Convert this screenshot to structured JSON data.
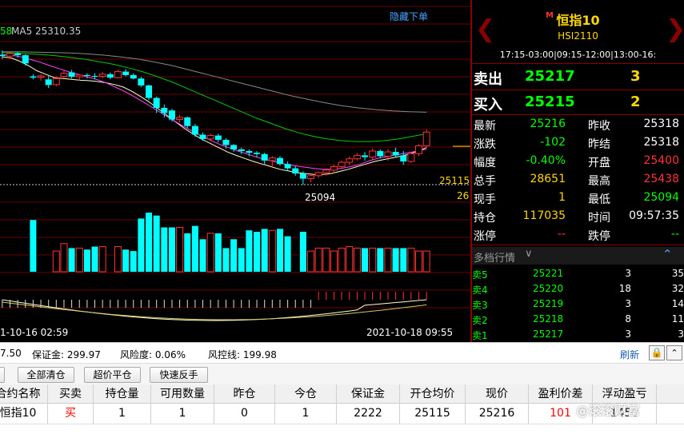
{
  "chart": {
    "top_link": "隐藏下单",
    "ma_label_prefix": "58",
    "ma5_label": "MA5 25310.35",
    "low_label": "25094",
    "price_right_label": "25115",
    "price_right_label2": "26",
    "time_start": "1-10-16 02:59",
    "time_end": "2021-10-18 09:55"
  },
  "chart_data": {
    "type": "candlestick",
    "title": "",
    "ma5_value": 25310.35,
    "low_marker": 25094,
    "last_price_marker": 25115,
    "x_start": "2021-10-16 02:59",
    "x_end": "2021-10-18 09:55",
    "candles": [
      {
        "o": 25395,
        "h": 25405,
        "l": 25385,
        "c": 25392
      },
      {
        "o": 25392,
        "h": 25402,
        "l": 25385,
        "c": 25398
      },
      {
        "o": 25398,
        "h": 25402,
        "l": 25388,
        "c": 25394
      },
      {
        "o": 25394,
        "h": 25396,
        "l": 25370,
        "c": 25375
      },
      {
        "o": 25345,
        "h": 25350,
        "l": 25338,
        "c": 25342
      },
      {
        "o": 25343,
        "h": 25350,
        "l": 25335,
        "c": 25346
      },
      {
        "o": 25338,
        "h": 25348,
        "l": 25318,
        "c": 25325
      },
      {
        "o": 25326,
        "h": 25345,
        "l": 25322,
        "c": 25340
      },
      {
        "o": 25345,
        "h": 25358,
        "l": 25340,
        "c": 25352
      },
      {
        "o": 25354,
        "h": 25360,
        "l": 25340,
        "c": 25344
      },
      {
        "o": 25344,
        "h": 25350,
        "l": 25335,
        "c": 25348
      },
      {
        "o": 25348,
        "h": 25352,
        "l": 25340,
        "c": 25346
      },
      {
        "o": 25346,
        "h": 25352,
        "l": 25338,
        "c": 25345
      },
      {
        "o": 25345,
        "h": 25355,
        "l": 25340,
        "c": 25350
      },
      {
        "o": 25350,
        "h": 25354,
        "l": 25338,
        "c": 25342
      },
      {
        "o": 25342,
        "h": 25360,
        "l": 25340,
        "c": 25356
      },
      {
        "o": 25356,
        "h": 25362,
        "l": 25345,
        "c": 25348
      },
      {
        "o": 25348,
        "h": 25352,
        "l": 25338,
        "c": 25340
      },
      {
        "o": 25340,
        "h": 25344,
        "l": 25320,
        "c": 25324
      },
      {
        "o": 25324,
        "h": 25326,
        "l": 25290,
        "c": 25295
      },
      {
        "o": 25295,
        "h": 25298,
        "l": 25260,
        "c": 25272
      },
      {
        "o": 25272,
        "h": 25280,
        "l": 25250,
        "c": 25260
      },
      {
        "o": 25266,
        "h": 25270,
        "l": 25240,
        "c": 25245
      },
      {
        "o": 25245,
        "h": 25256,
        "l": 25238,
        "c": 25250
      },
      {
        "o": 25250,
        "h": 25252,
        "l": 25225,
        "c": 25230
      },
      {
        "o": 25230,
        "h": 25235,
        "l": 25205,
        "c": 25210
      },
      {
        "o": 25210,
        "h": 25215,
        "l": 25196,
        "c": 25200
      },
      {
        "o": 25200,
        "h": 25212,
        "l": 25196,
        "c": 25208
      },
      {
        "o": 25208,
        "h": 25212,
        "l": 25192,
        "c": 25198
      },
      {
        "o": 25198,
        "h": 25202,
        "l": 25178,
        "c": 25186
      },
      {
        "o": 25186,
        "h": 25188,
        "l": 25170,
        "c": 25176
      },
      {
        "o": 25176,
        "h": 25180,
        "l": 25165,
        "c": 25172
      },
      {
        "o": 25172,
        "h": 25176,
        "l": 25160,
        "c": 25168
      },
      {
        "o": 25168,
        "h": 25172,
        "l": 25158,
        "c": 25165
      },
      {
        "o": 25165,
        "h": 25168,
        "l": 25140,
        "c": 25150
      },
      {
        "o": 25150,
        "h": 25160,
        "l": 25135,
        "c": 25156
      },
      {
        "o": 25156,
        "h": 25160,
        "l": 25138,
        "c": 25142
      },
      {
        "o": 25142,
        "h": 25148,
        "l": 25128,
        "c": 25132
      },
      {
        "o": 25132,
        "h": 25138,
        "l": 25115,
        "c": 25120
      },
      {
        "o": 25120,
        "h": 25125,
        "l": 25094,
        "c": 25108
      },
      {
        "o": 25108,
        "h": 25118,
        "l": 25100,
        "c": 25115
      },
      {
        "o": 25115,
        "h": 25125,
        "l": 25110,
        "c": 25122
      },
      {
        "o": 25122,
        "h": 25132,
        "l": 25115,
        "c": 25128
      },
      {
        "o": 25128,
        "h": 25140,
        "l": 25120,
        "c": 25136
      },
      {
        "o": 25136,
        "h": 25150,
        "l": 25132,
        "c": 25146
      },
      {
        "o": 25146,
        "h": 25160,
        "l": 25140,
        "c": 25154
      },
      {
        "o": 25154,
        "h": 25168,
        "l": 25150,
        "c": 25162
      },
      {
        "o": 25162,
        "h": 25170,
        "l": 25150,
        "c": 25158
      },
      {
        "o": 25158,
        "h": 25178,
        "l": 25152,
        "c": 25172
      },
      {
        "o": 25172,
        "h": 25176,
        "l": 25155,
        "c": 25160
      },
      {
        "o": 25160,
        "h": 25176,
        "l": 25150,
        "c": 25170
      },
      {
        "o": 25170,
        "h": 25180,
        "l": 25158,
        "c": 25162
      },
      {
        "o": 25162,
        "h": 25172,
        "l": 25140,
        "c": 25148
      },
      {
        "o": 25148,
        "h": 25170,
        "l": 25145,
        "c": 25166
      },
      {
        "o": 25166,
        "h": 25188,
        "l": 25160,
        "c": 25184
      },
      {
        "o": 25184,
        "h": 25222,
        "l": 25180,
        "c": 25216
      }
    ],
    "volumes": [
      0,
      0,
      0,
      0,
      35,
      0,
      0,
      14,
      19,
      16,
      16,
      15,
      17,
      17,
      0,
      17,
      15,
      14,
      36,
      40,
      38,
      30,
      30,
      30,
      26,
      31,
      22,
      26,
      26,
      16,
      22,
      16,
      28,
      27,
      29,
      28,
      29,
      24,
      0,
      27,
      14,
      16,
      16,
      14,
      16,
      17,
      16,
      16,
      16,
      16,
      16,
      16,
      16,
      16,
      14,
      14
    ],
    "ma_series": [
      {
        "color": "#ffffcc",
        "values": [
          25390,
          25388,
          25380,
          25370,
          25358,
          25350,
          25342,
          25340,
          25338,
          25336,
          25335,
          25333,
          25330,
          25326,
          25320,
          25310,
          25298,
          25285,
          25270,
          25255,
          25240,
          25225,
          25212,
          25200,
          25190,
          25180,
          25170,
          25162,
          25155,
          25148,
          25142,
          25136,
          25130,
          25126,
          25122,
          25120,
          25118,
          25118,
          25120,
          25125,
          25130,
          25136,
          25142,
          25148,
          25152,
          25156,
          25160,
          25165,
          25172,
          25180
        ]
      },
      {
        "color": "#ff44ff",
        "values": [
          25395,
          25394,
          25390,
          25384,
          25378,
          25370,
          25363,
          25356,
          25350,
          25344,
          25338,
          25330,
          25320,
          25310,
          25298,
          25285,
          25272,
          25258,
          25245,
          25232,
          25220,
          25208,
          25198,
          25188,
          25180,
          25172,
          25165,
          25158,
          25152,
          25147,
          25142,
          25138,
          25135,
          25132,
          25130,
          25130,
          25132,
          25136,
          25142,
          25150,
          25156,
          25160,
          25164,
          25168,
          25172,
          25176
        ]
      },
      {
        "color": "#00cc00",
        "values": [
          25400,
          25399,
          25397,
          25395,
          25392,
          25388,
          25384,
          25378,
          25372,
          25364,
          25355,
          25344,
          25332,
          25318,
          25304,
          25290,
          25276,
          25262,
          25248,
          25236,
          25224,
          25214,
          25206,
          25200,
          25196,
          25194,
          25194,
          25196,
          25200,
          25206,
          25212
        ]
      },
      {
        "color": "#888888",
        "values": [
          25402,
          25402,
          25401,
          25400,
          25399,
          25397,
          25394,
          25390,
          25385,
          25378,
          25370,
          25360,
          25350,
          25340,
          25330,
          25320,
          25310,
          25300,
          25292,
          25284,
          25277,
          25272,
          25268,
          25265,
          25263,
          25262
        ]
      }
    ]
  },
  "instrument": {
    "title": "恒指10",
    "code": "HSI2110",
    "hours": "17:15-03:00|09:15-12:00|13:00-16:"
  },
  "orderbook": {
    "ask_label": "卖出",
    "ask_price": "25217",
    "ask_qty": "3",
    "bid_label": "买入",
    "bid_price": "25215",
    "bid_qty": "2"
  },
  "quotes": [
    {
      "l1": "最新",
      "v1": "25216",
      "c1": "g",
      "l2": "昨收",
      "v2": "25318",
      "c2": "w"
    },
    {
      "l1": "涨跌",
      "v1": "-102",
      "c1": "g",
      "l2": "昨结",
      "v2": "25318",
      "c2": "w"
    },
    {
      "l1": "幅度",
      "v1": "-0.40%",
      "c1": "g",
      "l2": "开盘",
      "v2": "25400",
      "c2": "r"
    },
    {
      "l1": "总手",
      "v1": "28651",
      "c1": "y",
      "l2": "最高",
      "v2": "25438",
      "c2": "r"
    },
    {
      "l1": "现手",
      "v1": "1",
      "c1": "y",
      "l2": "最低",
      "v2": "25094",
      "c2": "g"
    },
    {
      "l1": "持仓",
      "v1": "117035",
      "c1": "y",
      "l2": "时间",
      "v2": "09:57:35",
      "c2": "w"
    },
    {
      "l1": "涨停",
      "v1": "--",
      "c1": "r",
      "l2": "跌停",
      "v2": "--",
      "c2": "g"
    }
  ],
  "depth": {
    "title": "多档行情",
    "rows": [
      {
        "label": "卖5",
        "price": "25221",
        "qty": "3",
        "extra": "35"
      },
      {
        "label": "卖4",
        "price": "25220",
        "qty": "18",
        "extra": "32"
      },
      {
        "label": "卖3",
        "price": "25219",
        "qty": "3",
        "extra": "14"
      },
      {
        "label": "卖2",
        "price": "25218",
        "qty": "8",
        "extra": "11"
      },
      {
        "label": "卖1",
        "price": "25217",
        "qty": "3",
        "extra": "3"
      }
    ]
  },
  "account": {
    "partial": "7.50",
    "margin": "保证金: 299.97",
    "risk": "风险度: 0.06%",
    "control": "风控线: 199.98",
    "refresh": "刷新"
  },
  "toolbar": {
    "close_all": "全部清仓",
    "over_close": "超价平仓",
    "reverse": "快速反手"
  },
  "positions": {
    "headers": [
      "合约名称",
      "买卖",
      "持仓量",
      "可用数量",
      "昨仓",
      "今仓",
      "保证金",
      "开仓均价",
      "现价",
      "盈利价差",
      "浮动盈亏"
    ],
    "row": [
      "恒指10",
      "买",
      "1",
      "1",
      "0",
      "1",
      "2222",
      "25115",
      "25216",
      "101",
      "1450"
    ]
  },
  "watermark": "@滚滚财富",
  "colors": {
    "up": "#ff3333",
    "down": "#00ffff",
    "accent_red": "#8b0000",
    "gold": "#ffd700",
    "green": "#00ff00"
  }
}
